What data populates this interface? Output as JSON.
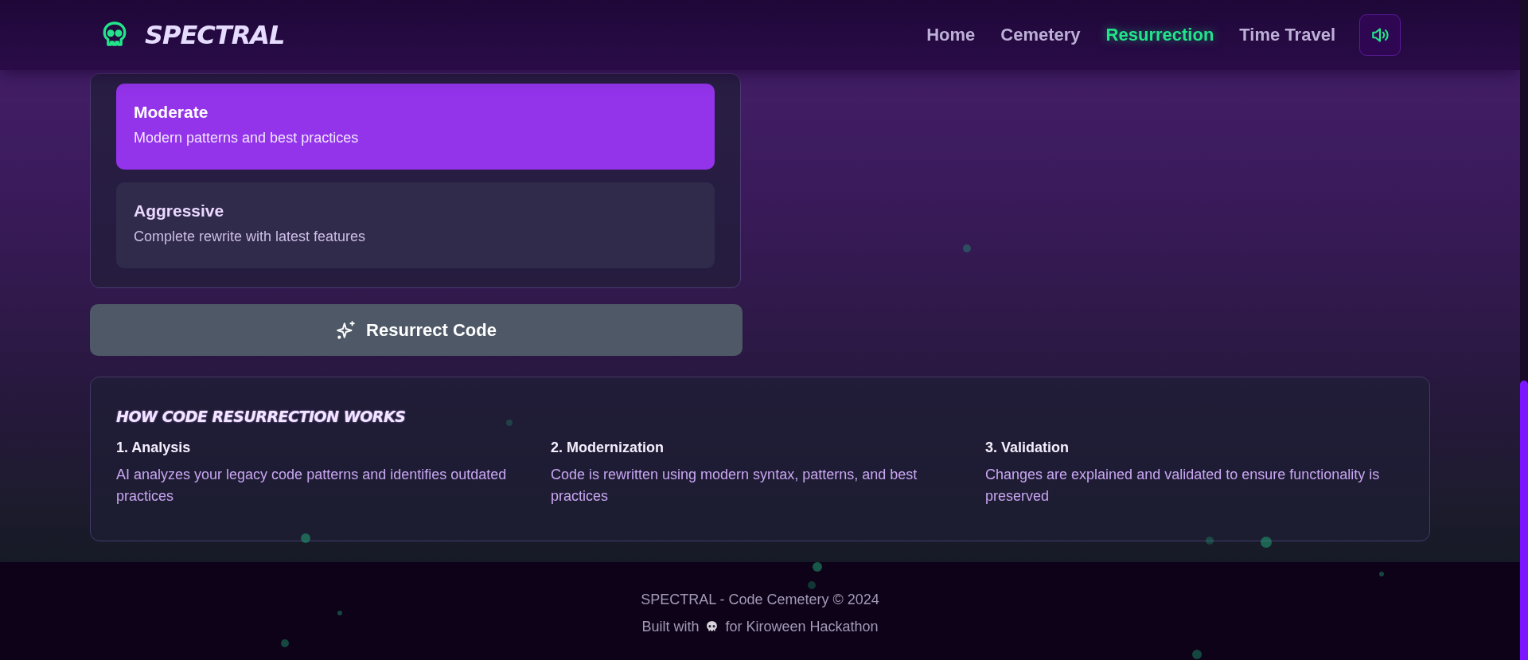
{
  "header": {
    "logo_text": "SPECTRAL",
    "nav": [
      {
        "label": "Home",
        "selected": false
      },
      {
        "label": "Cemetery",
        "selected": false
      },
      {
        "label": "Resurrection",
        "selected": true
      },
      {
        "label": "Time Travel",
        "selected": false
      }
    ]
  },
  "options": [
    {
      "title": "Moderate",
      "description": "Modern patterns and best practices",
      "selected": true
    },
    {
      "title": "Aggressive",
      "description": "Complete rewrite with latest features",
      "selected": false
    }
  ],
  "resurrect_button": {
    "label": "Resurrect Code",
    "disabled": true
  },
  "how_it_works": {
    "heading": "HOW CODE RESURRECTION WORKS",
    "steps": [
      {
        "title": "1. Analysis",
        "description": "AI analyzes your legacy code patterns and identifies outdated practices"
      },
      {
        "title": "2. Modernization",
        "description": "Code is rewritten using modern syntax, patterns, and best practices"
      },
      {
        "title": "3. Validation",
        "description": "Changes are explained and validated to ensure functionality is preserved"
      }
    ]
  },
  "footer": {
    "copyright": "SPECTRAL - Code Cemetery © 2024",
    "built_before": "Built with",
    "built_after": "for Kiroween Hackathon"
  }
}
